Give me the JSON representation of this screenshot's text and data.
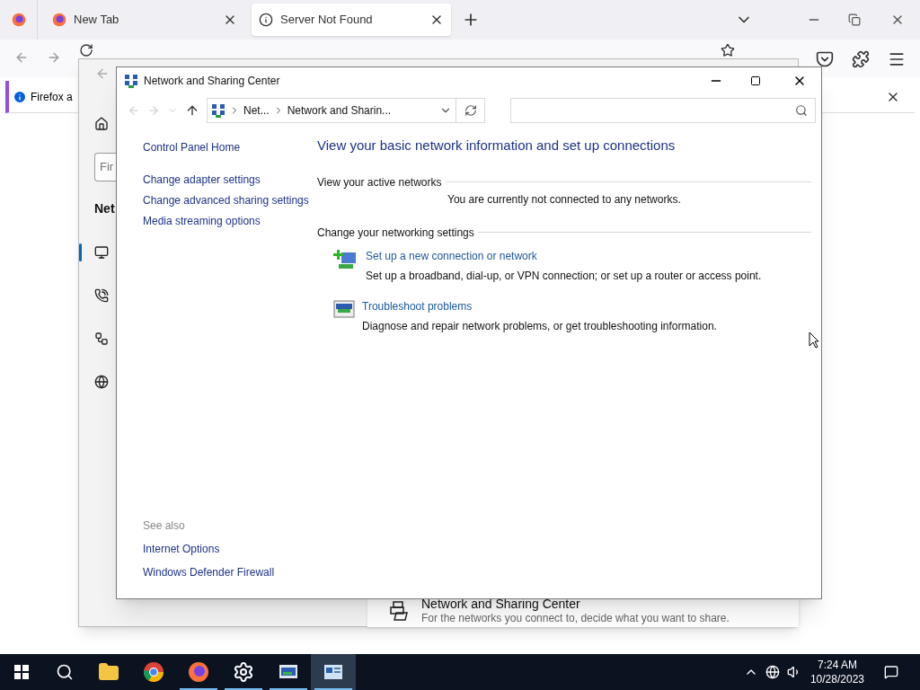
{
  "browser": {
    "tabs": [
      {
        "title": "New Tab",
        "selected": false
      },
      {
        "title": "Server Not Found",
        "selected": true
      }
    ],
    "notification": {
      "text": "Firefox a"
    }
  },
  "settings_window": {
    "search_placeholder": "Fir",
    "heading": "Net",
    "nav": [
      {
        "kind": "ethernet",
        "selected": true
      },
      {
        "kind": "dialup",
        "selected": false
      },
      {
        "kind": "vpn",
        "selected": false
      },
      {
        "kind": "proxy",
        "selected": false
      }
    ],
    "related": {
      "title": "Network and Sharing Center",
      "description": "For the networks you connect to, decide what you want to share."
    }
  },
  "window": {
    "title": "Network and Sharing Center",
    "breadcrumb": [
      "Net...",
      "Network and Sharin..."
    ],
    "sidebar": {
      "links": [
        "Control Panel Home",
        "Change adapter settings",
        "Change advanced sharing settings",
        "Media streaming options"
      ],
      "see_also_label": "See also",
      "see_also": [
        "Internet Options",
        "Windows Defender Firewall"
      ]
    },
    "heading": "View your basic network information and set up connections",
    "active_networks": {
      "title": "View your active networks",
      "text": "You are currently not connected to any networks."
    },
    "settings": {
      "title": "Change your networking settings",
      "tasks": [
        {
          "kind": "new-connection",
          "link": "Set up a new connection or network",
          "description": "Set up a broadband, dial-up, or VPN connection; or set up a router or access point."
        },
        {
          "kind": "troubleshoot",
          "link": "Troubleshoot problems",
          "description": "Diagnose and repair network problems, or get troubleshooting information."
        }
      ]
    }
  },
  "taskbar": {
    "apps": [
      {
        "kind": "explorer",
        "running": false,
        "selected": false
      },
      {
        "kind": "chrome",
        "running": false,
        "selected": false
      },
      {
        "kind": "firefox",
        "running": true,
        "selected": false
      },
      {
        "kind": "settings",
        "running": true,
        "selected": false
      },
      {
        "kind": "control-panel",
        "running": true,
        "selected": false
      },
      {
        "kind": "network",
        "running": true,
        "selected": true
      }
    ],
    "time": "7:24 AM",
    "date": "10/28/2023"
  }
}
